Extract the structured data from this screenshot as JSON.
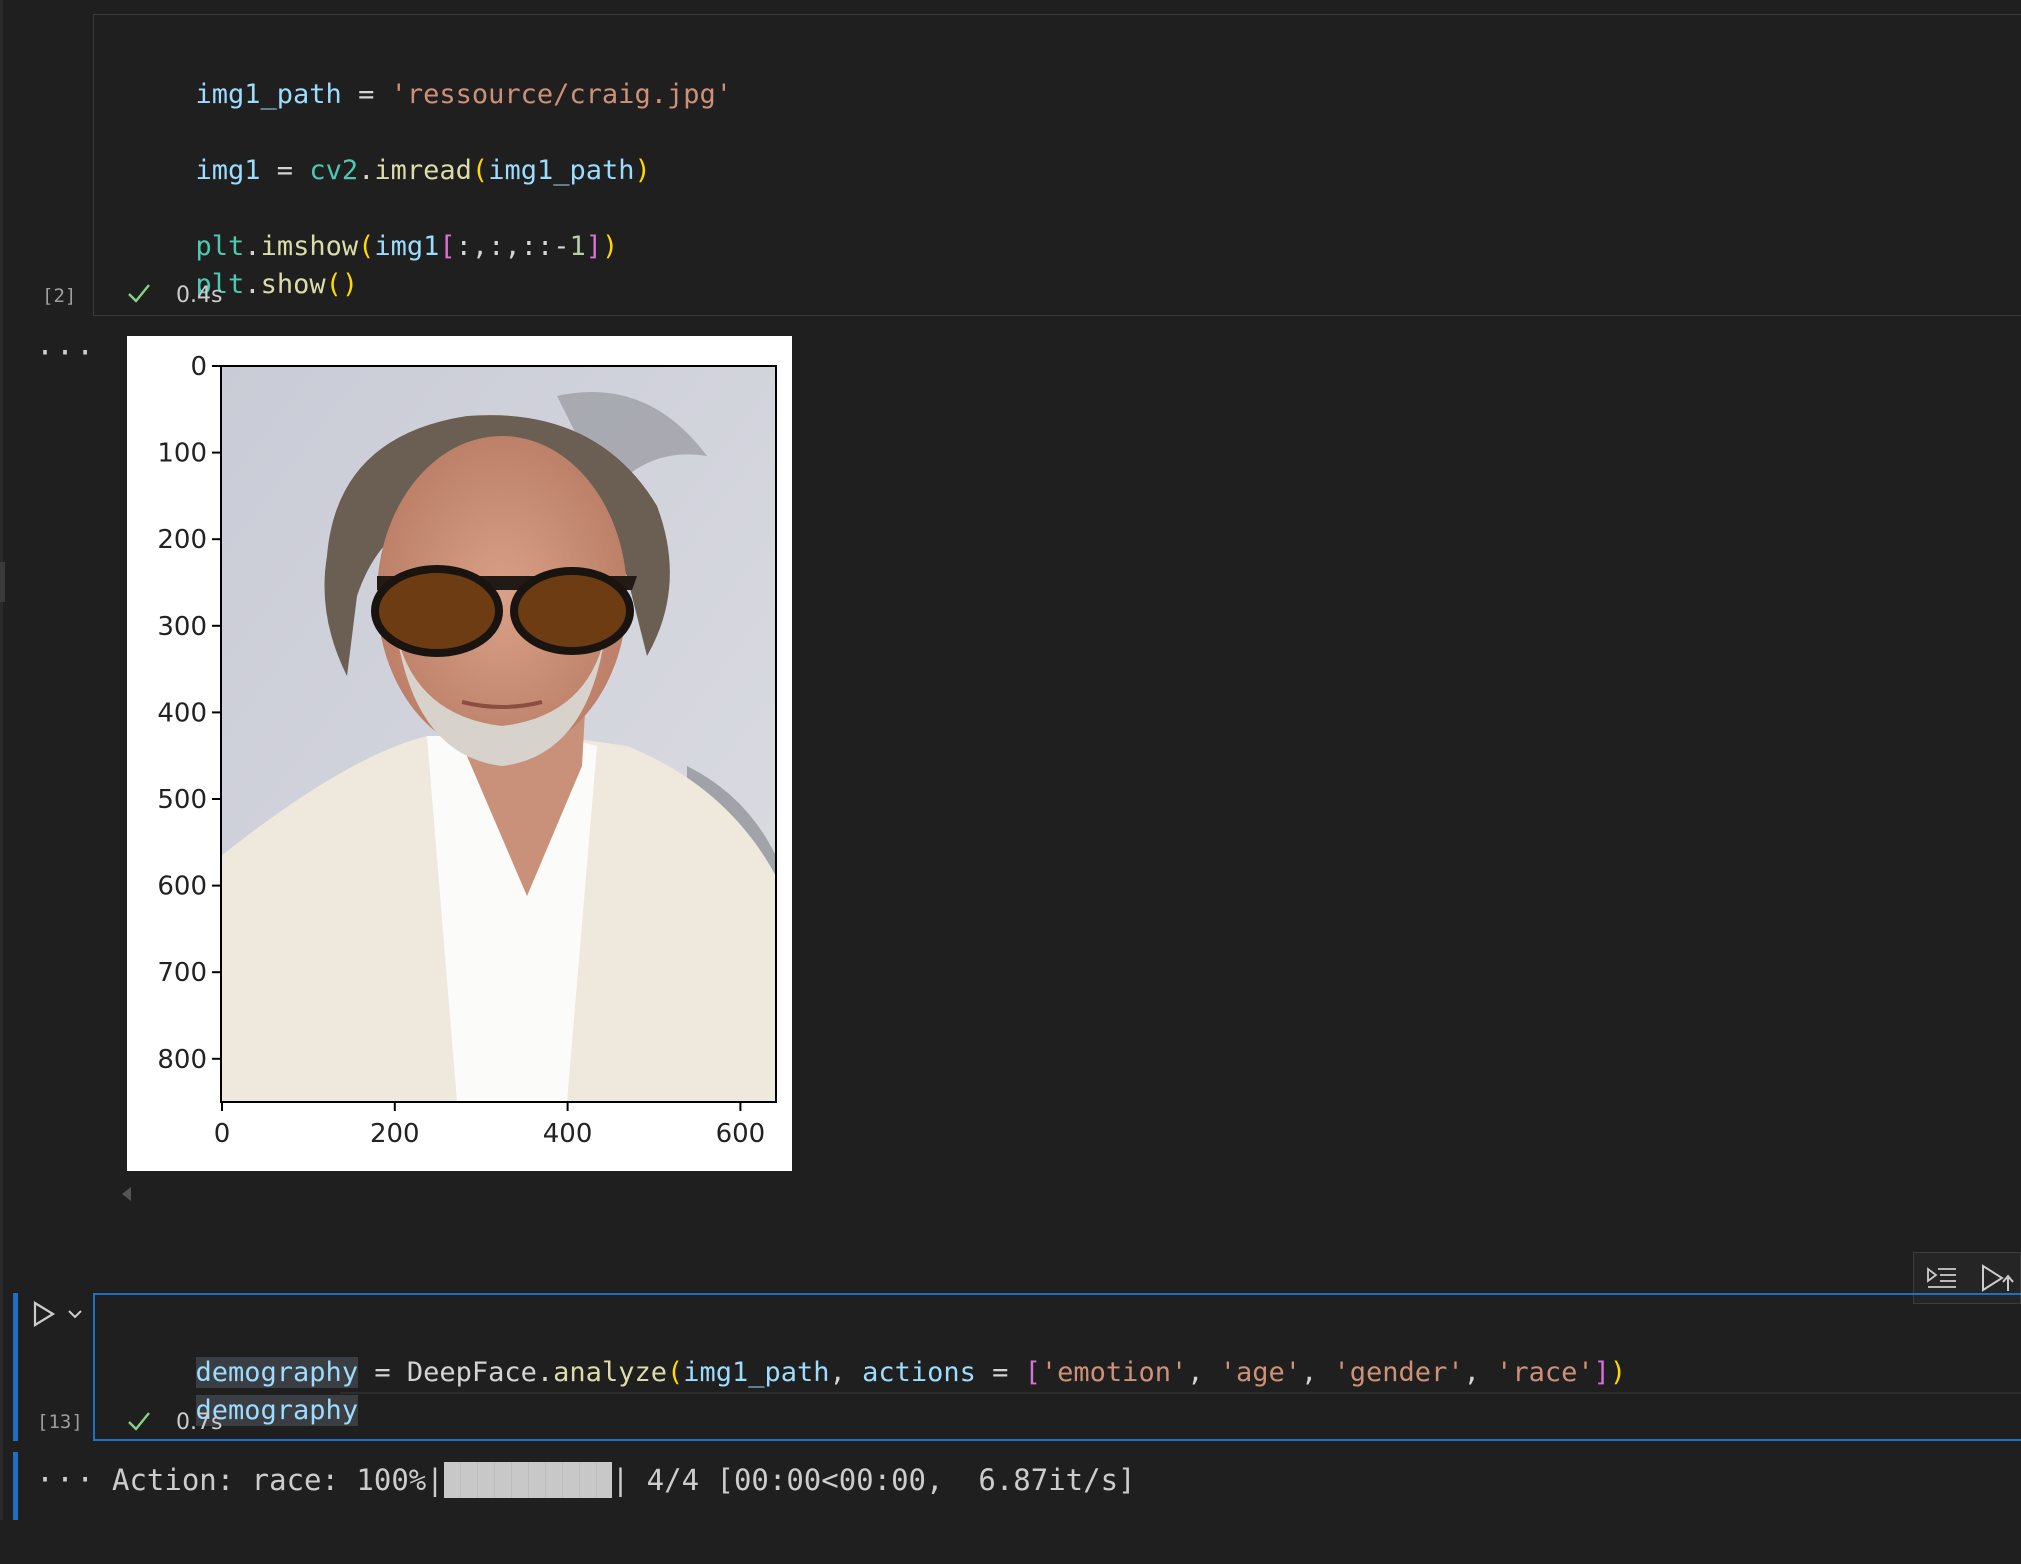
{
  "cell1": {
    "code": {
      "line1": {
        "var": "img1_path",
        "op": " = ",
        "str": "'ressource/craig.jpg'"
      },
      "line2": {
        "var": "img1",
        "op": " = ",
        "mod": "cv2",
        "dot": ".",
        "fn": "imread",
        "open": "(",
        "arg": "img1_path",
        "close": ")"
      },
      "line3": {
        "mod": "plt",
        "dot": ".",
        "fn": "imshow",
        "open": "(",
        "arg": "img1",
        "bopen": "[",
        "slice": ":,:,::-",
        "num": "1",
        "bclose": "]",
        "close": ")"
      },
      "line4": {
        "mod": "plt",
        "dot": ".",
        "fn": "show",
        "parens": "()"
      }
    },
    "exec_count": "[2]",
    "status_icon": "check-icon",
    "time": "0.4s"
  },
  "output1": {
    "more_icon": "more-icon",
    "more_text": "···",
    "plot": {
      "y_ticks": [
        "0",
        "100",
        "200",
        "300",
        "400",
        "500",
        "600",
        "700",
        "800"
      ],
      "x_ticks": [
        "0",
        "200",
        "400",
        "600"
      ]
    }
  },
  "cell2": {
    "code": {
      "line1": {
        "var": "demography",
        "op": " = ",
        "cls": "DeepFace",
        "dot": ".",
        "fn": "analyze",
        "open": "(",
        "arg": "img1_path",
        "comma": ", ",
        "kw": "actions",
        "eq": " = ",
        "lopen": "[",
        "s1": "'emotion'",
        "c1": ", ",
        "s2": "'age'",
        "c2": ", ",
        "s3": "'gender'",
        "c3": ", ",
        "s4": "'race'",
        "lclose": "]",
        "close": ")"
      },
      "line2": {
        "var": "demography"
      }
    },
    "exec_count": "[13]",
    "run_icon": "play-icon",
    "expand_icon": "chevron-down-icon",
    "status_icon": "check-icon",
    "time": "0.7s",
    "toolbar": {
      "icon1": "run-by-line-icon",
      "icon2": "execute-above-icon"
    }
  },
  "output2": {
    "more_text": "···",
    "progress_prefix": "Action: race: 100%|",
    "progress_suffix": "| 4/4 [00:00<00:00,  6.87it/s]",
    "progress_fraction": 1.0
  }
}
